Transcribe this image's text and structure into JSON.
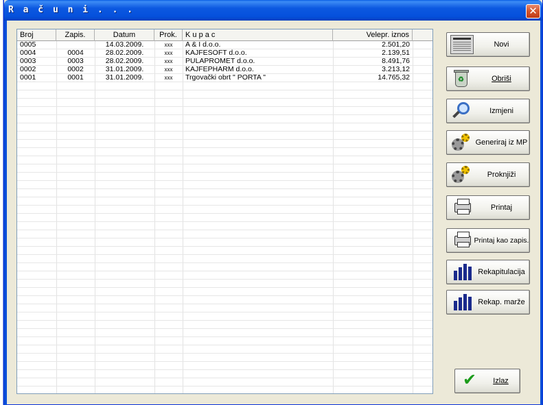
{
  "window": {
    "title": "R a č u n i  . . .",
    "close_glyph": "✕"
  },
  "columns": [
    "Broj",
    "Zapis.",
    "Datum",
    "Prok.",
    "K u p a c",
    "Velepr. iznos"
  ],
  "rows": [
    {
      "broj": "0005",
      "zapis": "",
      "datum": "14.03.2009.",
      "prok": "xxx",
      "kupac": "A & I  d.o.o.",
      "iznos": "2.501,20"
    },
    {
      "broj": "0004",
      "zapis": "0004",
      "datum": "28.02.2009.",
      "prok": "xxx",
      "kupac": "KAJFESOFT d.o.o.",
      "iznos": "2.139,51"
    },
    {
      "broj": "0003",
      "zapis": "0003",
      "datum": "28.02.2009.",
      "prok": "xxx",
      "kupac": "PULAPROMET d.o.o.",
      "iznos": "8.491,76"
    },
    {
      "broj": "0002",
      "zapis": "0002",
      "datum": "31.01.2009.",
      "prok": "xxx",
      "kupac": "KAJFEPHARM d.o.o.",
      "iznos": "3.213,12"
    },
    {
      "broj": "0001",
      "zapis": "0001",
      "datum": "31.01.2009.",
      "prok": "xxx",
      "kupac": "Trgovački obrt \" PORTA \"",
      "iznos": "14.765,32"
    }
  ],
  "buttons": {
    "novi": "Novi",
    "obrisi": "Obriši",
    "izmjeni": "Izmjeni",
    "generiraj": "Generiraj iz MP",
    "proknjizi": "Proknjiži",
    "printaj": "Printaj",
    "printaj_zapis": "Printaj kao zapis.",
    "rekapitulacija": "Rekapitulacija",
    "rekap_marze": "Rekap. marže",
    "izlaz": "Izlaz"
  },
  "icons": {
    "novi": "document-icon",
    "obrisi": "recycle-bin-icon",
    "izmjeni": "magnifier-icon",
    "generiraj": "gears-icon",
    "proknjizi": "gears-icon",
    "printaj": "printer-icon",
    "printaj_zapis": "printer-icon",
    "rekapitulacija": "bar-chart-icon",
    "rekap_marze": "bar-chart-icon",
    "izlaz": "checkmark-icon"
  },
  "colors": {
    "titlebar": "#0550dc",
    "window_bg": "#ece9d8",
    "close": "#d4542c"
  }
}
